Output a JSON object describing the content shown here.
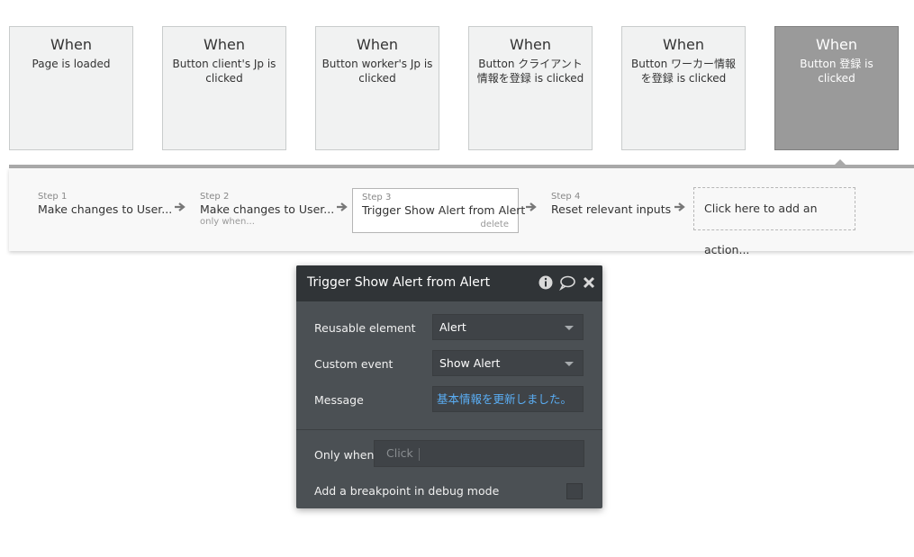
{
  "events": [
    {
      "when": "When",
      "desc": "Page is loaded",
      "selected": false
    },
    {
      "when": "When",
      "desc": "Button client's Jp is clicked",
      "selected": false
    },
    {
      "when": "When",
      "desc": "Button worker's Jp is clicked",
      "selected": false
    },
    {
      "when": "When",
      "desc": "Button クライアント情報を登録 is clicked",
      "selected": false
    },
    {
      "when": "When",
      "desc": "Button ワーカー情報を登録 is clicked",
      "selected": false
    },
    {
      "when": "When",
      "desc": "Button 登録 is clicked",
      "selected": true
    }
  ],
  "steps": [
    {
      "num": "Step 1",
      "title": "Make changes to User...",
      "sub": ""
    },
    {
      "num": "Step 2",
      "title": "Make changes to User...",
      "sub": "only when..."
    },
    {
      "num": "Step 3",
      "title": "Trigger Show Alert from Alert",
      "sub": "",
      "delete_label": "delete"
    },
    {
      "num": "Step 4",
      "title": "Reset relevant inputs",
      "sub": ""
    }
  ],
  "add_action_label": "Click here to add an action...",
  "editor": {
    "title": "Trigger Show Alert from Alert",
    "icons": [
      "info-icon",
      "comment-icon",
      "close-icon"
    ],
    "reusable_label": "Reusable element",
    "reusable_value": "Alert",
    "custom_event_label": "Custom event",
    "custom_event_value": "Show Alert",
    "message_label": "Message",
    "message_value": "基本情報を更新しました。",
    "only_when_label": "Only when",
    "only_when_placeholder": "Click",
    "breakpoint_label": "Add a breakpoint in debug mode",
    "breakpoint_checked": false
  },
  "colors": {
    "selected_card": "#9a9a9a",
    "editor_bg": "#4b5054",
    "editor_header": "#303437",
    "message_text": "#5aaef5"
  }
}
